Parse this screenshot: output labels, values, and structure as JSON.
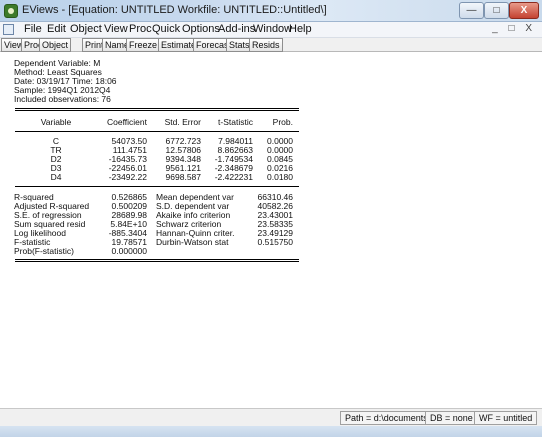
{
  "window": {
    "title": "EViews - [Equation: UNTITLED   Workfile: UNTITLED::Untitled\\]",
    "min_glyph": "—",
    "max_glyph": "□",
    "close_glyph": "X"
  },
  "menu": {
    "items": [
      "File",
      "Edit",
      "Object",
      "View",
      "Proc",
      "Quick",
      "Options",
      "Add-ins",
      "Window",
      "Help"
    ],
    "doc_controls": "_ □ X"
  },
  "toolbar": {
    "buttons": [
      "View",
      "Proc",
      "Object",
      "Print",
      "Name",
      "Freeze",
      "Estimate",
      "Forecast",
      "Stats",
      "Resids"
    ]
  },
  "output": {
    "header": [
      "Dependent Variable: M",
      "Method: Least Squares",
      "Date: 03/19/17   Time: 18:06",
      "Sample: 1994Q1 2012Q4",
      "Included observations: 76"
    ],
    "coef_columns": [
      "Variable",
      "Coefficient",
      "Std. Error",
      "t-Statistic",
      "Prob."
    ],
    "coef_rows": [
      [
        "C",
        "54073.50",
        "6772.723",
        "7.984011",
        "0.0000"
      ],
      [
        "TR",
        "111.4751",
        "12.57806",
        "8.862663",
        "0.0000"
      ],
      [
        "D2",
        "-16435.73",
        "9394.348",
        "-1.749534",
        "0.0845"
      ],
      [
        "D3",
        "-22456.01",
        "9561.121",
        "-2.348679",
        "0.0216"
      ],
      [
        "D4",
        "-23492.22",
        "9698.587",
        "-2.422231",
        "0.0180"
      ]
    ],
    "stats_rows": [
      [
        "R-squared",
        "0.526865",
        "Mean dependent var",
        "66310.46"
      ],
      [
        "Adjusted R-squared",
        "0.500209",
        "S.D. dependent var",
        "40582.26"
      ],
      [
        "S.E. of regression",
        "28689.98",
        "Akaike info criterion",
        "23.43001"
      ],
      [
        "Sum squared resid",
        "5.84E+10",
        "Schwarz criterion",
        "23.58335"
      ],
      [
        "Log likelihood",
        "-885.3404",
        "Hannan-Quinn criter.",
        "23.49129"
      ],
      [
        "F-statistic",
        "19.78571",
        "Durbin-Watson stat",
        "0.515750"
      ],
      [
        "Prob(F-statistic)",
        "0.000000",
        "",
        ""
      ]
    ]
  },
  "status": {
    "path": "Path = d:\\documents",
    "db": "DB = none",
    "wf": "WF = untitled"
  }
}
